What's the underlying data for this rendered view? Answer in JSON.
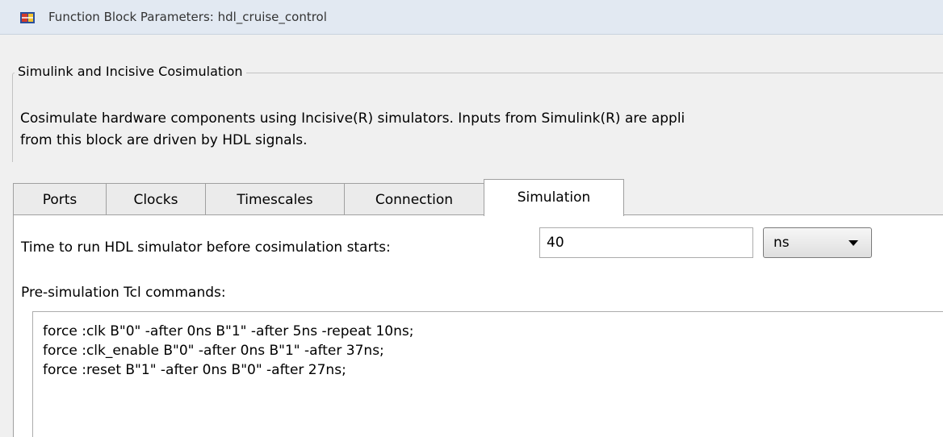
{
  "window": {
    "title": "Function Block Parameters: hdl_cruise_control"
  },
  "group": {
    "legend": "Simulink and Incisive Cosimulation",
    "description_lines": [
      "Cosimulate hardware components using Incisive(R) simulators.  Inputs from Simulink(R) are appli",
      "from this block are driven by HDL signals."
    ]
  },
  "tabs": [
    {
      "label": "Ports",
      "active": false
    },
    {
      "label": "Clocks",
      "active": false
    },
    {
      "label": "Timescales",
      "active": false
    },
    {
      "label": "Connection",
      "active": false
    },
    {
      "label": "Simulation",
      "active": true
    }
  ],
  "simulation": {
    "time_label": "Time to run HDL simulator before cosimulation starts:",
    "time_value": "40",
    "time_unit": "ns",
    "pre_sim_label": "Pre-simulation Tcl commands:",
    "tcl_lines": [
      "force :clk B\"0\" -after 0ns B\"1\" -after 5ns -repeat 10ns;",
      "force :clk_enable B\"0\" -after 0ns B\"1\" -after 37ns;",
      "force :reset B\"1\" -after 0ns B\"0\" -after 27ns;"
    ]
  },
  "icons": {
    "app": "simulink-block-icon",
    "dropdown": "chevron-down-icon"
  }
}
